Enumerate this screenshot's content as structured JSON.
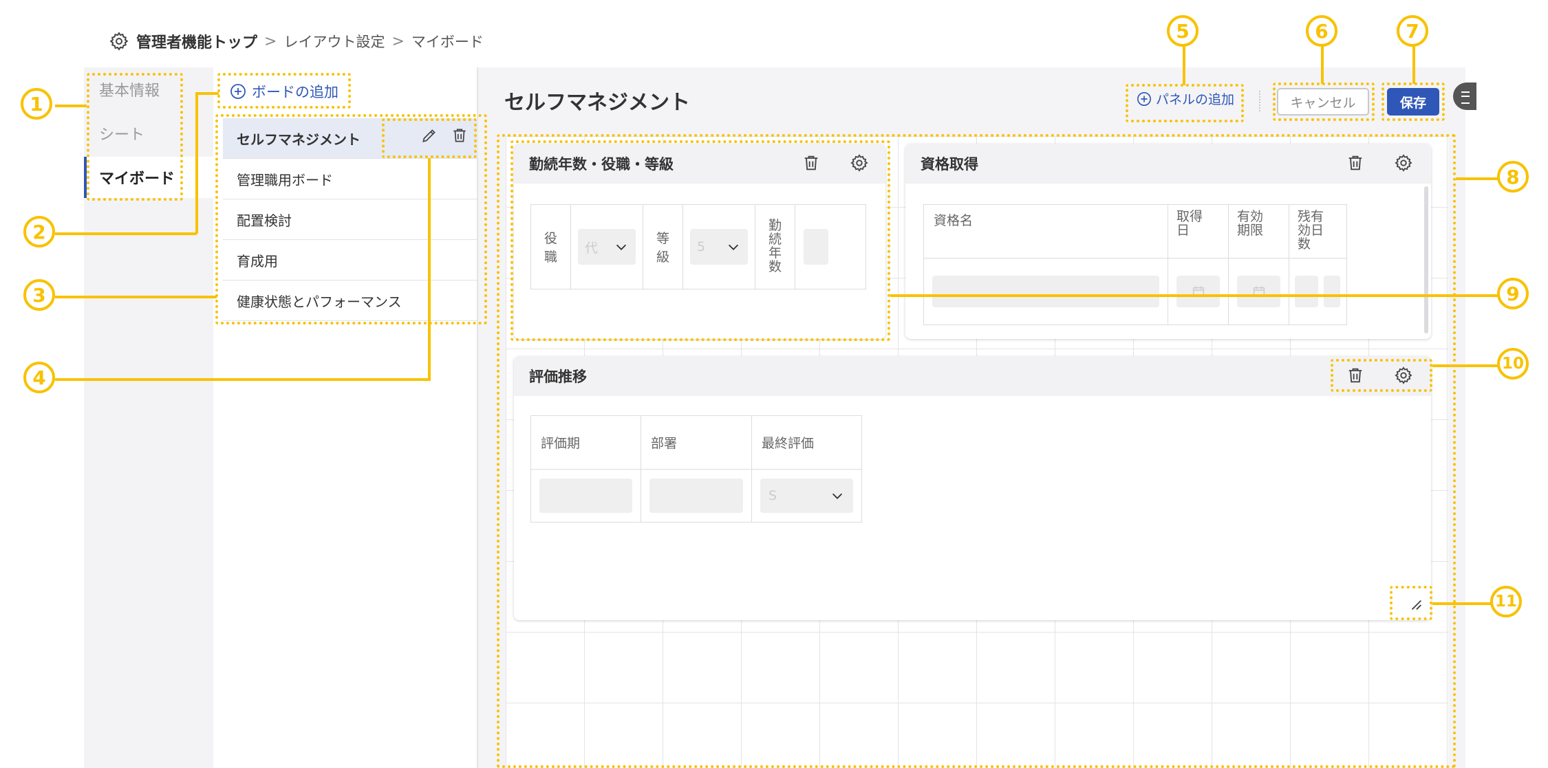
{
  "breadcrumb": {
    "home": "管理者機能トップ",
    "separator": ">",
    "layout": "レイアウト設定",
    "current": "マイボード"
  },
  "left_nav": {
    "items": [
      {
        "label": "基本情報"
      },
      {
        "label": "シート"
      },
      {
        "label": "マイボード"
      }
    ]
  },
  "boards": {
    "add_label": "ボードの追加",
    "items": [
      {
        "label": "セルフマネジメント"
      },
      {
        "label": "管理職用ボード"
      },
      {
        "label": "配置検討"
      },
      {
        "label": "育成用"
      },
      {
        "label": "健康状態とパフォーマンス"
      }
    ]
  },
  "main": {
    "title": "セルフマネジメント",
    "add_panel_label": "パネルの追加",
    "cancel_label": "キャンセル",
    "save_label": "保存"
  },
  "panels": {
    "p1": {
      "title": "勤続年数・役職・等級",
      "role_label": "役\n職",
      "role_value": "代",
      "grade_label": "等\n級",
      "grade_value": "5",
      "years_label": "勤\n続\n年\n数"
    },
    "p2": {
      "title": "資格取得",
      "col_name": "資格名",
      "col_acquired": "取得\n日",
      "col_valid": "有効\n期限",
      "col_remaining": "残有\n効日\n数"
    },
    "p3": {
      "title": "評価推移",
      "col_period": "評価期",
      "col_dept": "部署",
      "col_final": "最終評価",
      "final_value": "S"
    }
  },
  "annotations": [
    "1",
    "2",
    "3",
    "4",
    "5",
    "6",
    "7",
    "8",
    "9",
    "10",
    "11"
  ],
  "colors": {
    "accent": "#2f57b7",
    "annotation": "#f8c200"
  }
}
